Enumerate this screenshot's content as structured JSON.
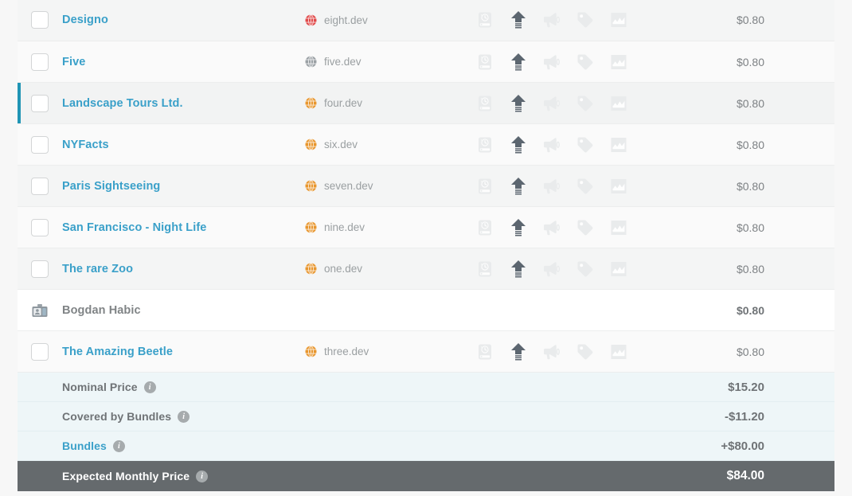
{
  "theme": {
    "link_color": "#3aa0c9",
    "selected_bar_color": "#2095b5",
    "summary_bg": "#eef6f8",
    "total_bg": "#656a6d",
    "globe_red": "#e04a4a",
    "globe_gray": "#9aa0a4",
    "globe_orange": "#e8962e"
  },
  "table": {
    "action_icons": [
      {
        "name": "backup-icon",
        "state": "disabled"
      },
      {
        "name": "upload-icon",
        "state": "enabled"
      },
      {
        "name": "megaphone-icon",
        "state": "disabled"
      },
      {
        "name": "price-tag-icon",
        "state": "disabled"
      },
      {
        "name": "analytics-chart-icon",
        "state": "disabled"
      }
    ],
    "rows": [
      {
        "type": "site",
        "name": "Designo",
        "domain": "eight.dev",
        "globe": "red",
        "price": "$0.80",
        "selected": false,
        "shade": "alt"
      },
      {
        "type": "site",
        "name": "Five",
        "domain": "five.dev",
        "globe": "gray",
        "price": "$0.80",
        "selected": false,
        "shade": "base"
      },
      {
        "type": "site",
        "name": "Landscape Tours Ltd.",
        "domain": "four.dev",
        "globe": "orange",
        "price": "$0.80",
        "selected": true,
        "shade": "sel"
      },
      {
        "type": "site",
        "name": "NYFacts",
        "domain": "six.dev",
        "globe": "orange",
        "price": "$0.80",
        "selected": false,
        "shade": "base"
      },
      {
        "type": "site",
        "name": "Paris Sightseeing",
        "domain": "seven.dev",
        "globe": "orange",
        "price": "$0.80",
        "selected": false,
        "shade": "alt"
      },
      {
        "type": "site",
        "name": "San Francisco - Night Life",
        "domain": "nine.dev",
        "globe": "orange",
        "price": "$0.80",
        "selected": false,
        "shade": "base"
      },
      {
        "type": "site",
        "name": "The rare Zoo",
        "domain": "one.dev",
        "globe": "orange",
        "price": "$0.80",
        "selected": false,
        "shade": "alt"
      },
      {
        "type": "user",
        "name": "Bogdan Habic",
        "domain": "",
        "globe": "",
        "price": "$0.80",
        "selected": false,
        "shade": "plain"
      },
      {
        "type": "site",
        "name": "The Amazing Beetle",
        "domain": "three.dev",
        "globe": "orange",
        "price": "$0.80",
        "selected": false,
        "shade": "base"
      }
    ],
    "summary": [
      {
        "label": "Nominal Price",
        "value": "$15.20",
        "link": false,
        "total": false
      },
      {
        "label": "Covered by Bundles",
        "value": "-$11.20",
        "link": false,
        "total": false
      },
      {
        "label": "Bundles",
        "value": "+$80.00",
        "link": true,
        "total": false
      },
      {
        "label": "Expected Monthly Price",
        "value": "$84.00",
        "link": false,
        "total": true
      }
    ],
    "info_glyph": "i"
  }
}
